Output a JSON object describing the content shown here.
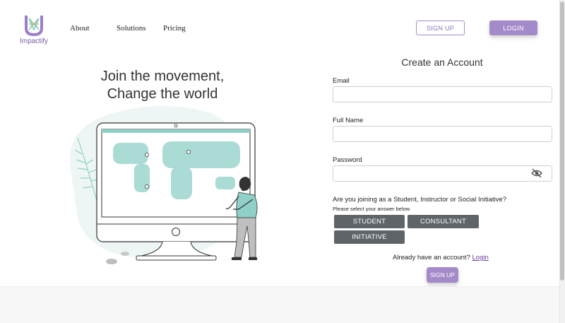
{
  "brand": {
    "name": "Impactify"
  },
  "nav": {
    "about": "About",
    "solutions": "Solutions",
    "pricing": "Pricing"
  },
  "header": {
    "signup_label": "SIGN UP",
    "login_label": "LOGIN"
  },
  "hero": {
    "line1": "Join the movement,",
    "line2": "Change the world"
  },
  "form": {
    "title": "Create an Account",
    "email_label": "Email",
    "email_value": "",
    "fullname_label": "Full Name",
    "fullname_value": "",
    "password_label": "Password",
    "password_value": "",
    "question": "Are you joining as a Student, Instructor or Social Initiative?",
    "hint": "Please select your answer below",
    "roles": [
      "STUDENT",
      "CONSULTANT",
      "INITIATIVE"
    ],
    "already_text": "Already have an account?",
    "login_link": "Login",
    "submit_label": "SIGN UP"
  },
  "colors": {
    "accent": "#a58ac9",
    "role_button": "#5f6469",
    "link": "#6a3fa0",
    "map_teal": "#8fd0c8"
  },
  "icons": {
    "password_toggle": "eye-slash-icon",
    "logo": "impactify-u-logo"
  }
}
